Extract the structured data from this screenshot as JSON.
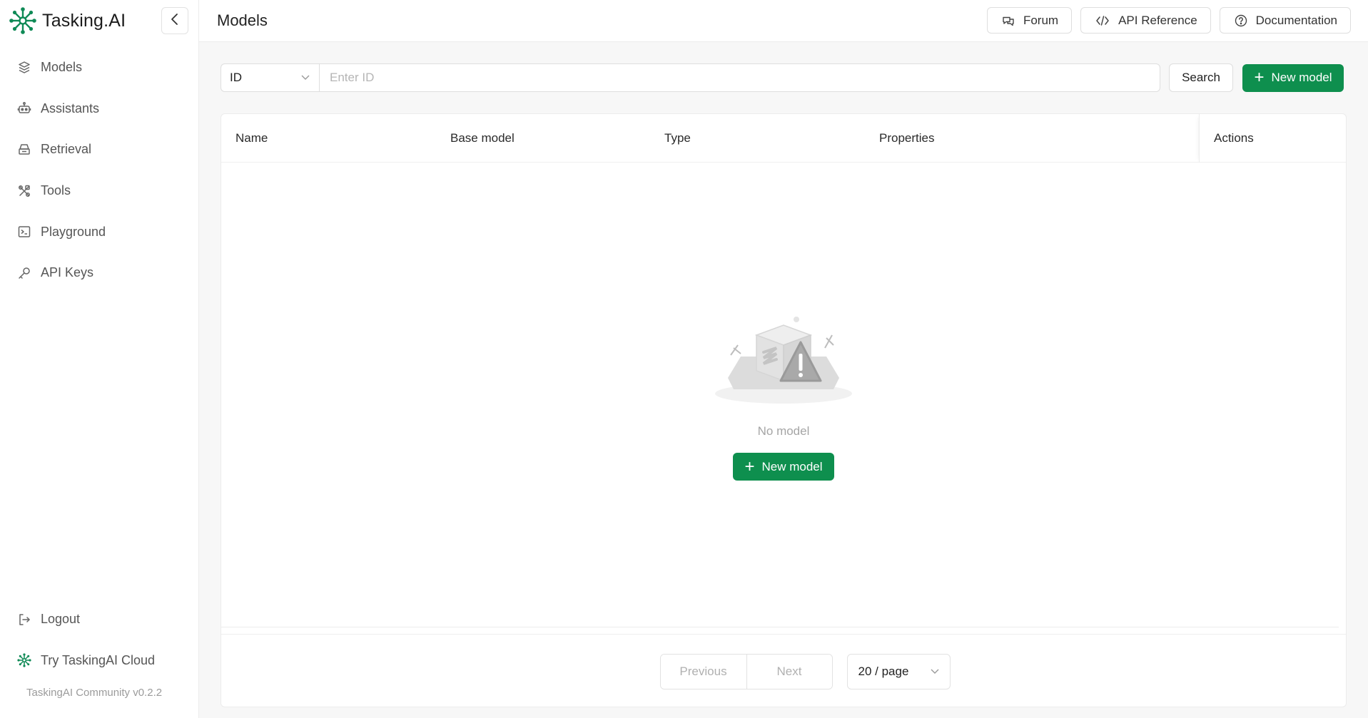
{
  "brand": {
    "name": "Tasking.AI",
    "logo_icon": "tasking-logo-icon"
  },
  "sidebar": {
    "items": [
      {
        "label": "Models",
        "icon": "models-icon"
      },
      {
        "label": "Assistants",
        "icon": "robot-icon"
      },
      {
        "label": "Retrieval",
        "icon": "database-icon"
      },
      {
        "label": "Tools",
        "icon": "tools-icon"
      },
      {
        "label": "Playground",
        "icon": "terminal-icon"
      },
      {
        "label": "API Keys",
        "icon": "key-icon"
      }
    ],
    "bottom": [
      {
        "label": "Logout",
        "icon": "logout-icon"
      },
      {
        "label": "Try TaskingAI Cloud",
        "icon": "tasking-logo-icon"
      }
    ],
    "version": "TaskingAI Community v0.2.2"
  },
  "header": {
    "title": "Models",
    "actions": [
      {
        "label": "Forum",
        "icon": "chat-bubbles-icon"
      },
      {
        "label": "API Reference",
        "icon": "code-icon"
      },
      {
        "label": "Documentation",
        "icon": "help-circle-icon"
      }
    ]
  },
  "search": {
    "field_select": "ID",
    "placeholder": "Enter ID",
    "value": "",
    "search_label": "Search",
    "new_model_label": "New model"
  },
  "table": {
    "columns": [
      "Name",
      "Base model",
      "Type",
      "Properties",
      "Actions"
    ],
    "rows": [],
    "empty_text": "No model",
    "empty_action_label": "New model"
  },
  "pagination": {
    "previous_label": "Previous",
    "next_label": "Next",
    "page_size": "20 / page"
  },
  "colors": {
    "primary": "#0e8f4e",
    "brand_logo": "#0f8a56"
  }
}
